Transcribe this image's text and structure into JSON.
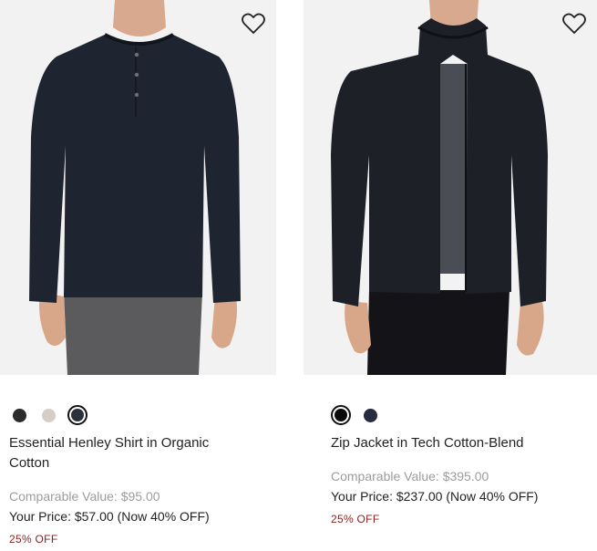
{
  "products": [
    {
      "name": "Essential Henley Shirt in Organic Cotton",
      "wishlist_icon": "heart-outline-icon",
      "swatches": [
        {
          "color": "#2b2b2b",
          "selected": false
        },
        {
          "color": "#d6cec6",
          "selected": false
        },
        {
          "color": "#2a313b",
          "selected": true
        }
      ],
      "comparable_value": "Comparable Value: $95.00",
      "your_price": "Your Price: $57.00 (Now 40% OFF)",
      "discount": "25% OFF"
    },
    {
      "name": "Zip Jacket in Tech Cotton-Blend",
      "wishlist_icon": "heart-outline-icon",
      "swatches": [
        {
          "color": "#0a0a0a",
          "selected": true
        },
        {
          "color": "#262b3d",
          "selected": false
        }
      ],
      "comparable_value": "Comparable Value: $395.00",
      "your_price": "Your Price: $237.00 (Now 40% OFF)",
      "discount": "25% OFF"
    }
  ],
  "colors": {
    "image_background": "#f2f2f2",
    "discount_text": "#8b1d1d",
    "muted_text": "#9c9c9c"
  }
}
